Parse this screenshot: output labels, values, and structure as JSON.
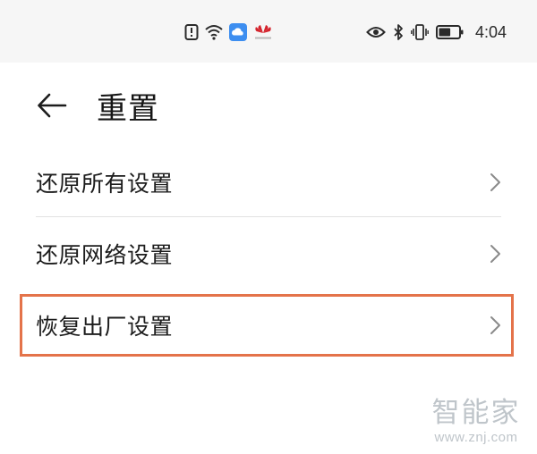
{
  "status_bar": {
    "time": "4:04",
    "left_icons": [
      "notification-alert-icon",
      "wifi-icon",
      "cloud-app-icon",
      "huawei-logo-icon"
    ],
    "right_icons": [
      "eye-comfort-icon",
      "bluetooth-icon",
      "vibrate-icon",
      "battery-icon"
    ],
    "battery_level_fraction": 0.6
  },
  "header": {
    "title": "重置",
    "back_icon": "arrow-left-icon"
  },
  "menu": {
    "items": [
      {
        "label": "还原所有设置",
        "icon": "chevron-right-icon"
      },
      {
        "label": "还原网络设置",
        "icon": "chevron-right-icon"
      },
      {
        "label": "恢复出厂设置",
        "icon": "chevron-right-icon",
        "highlighted": true
      }
    ]
  },
  "watermark": {
    "brand": "智能家",
    "url": "www.znj.com"
  },
  "colors": {
    "highlight": "#e4734a",
    "status_bar_bg": "#f6f6f6",
    "cloud_blue": "#3d8ef0",
    "huawei_red": "#d4232c"
  }
}
